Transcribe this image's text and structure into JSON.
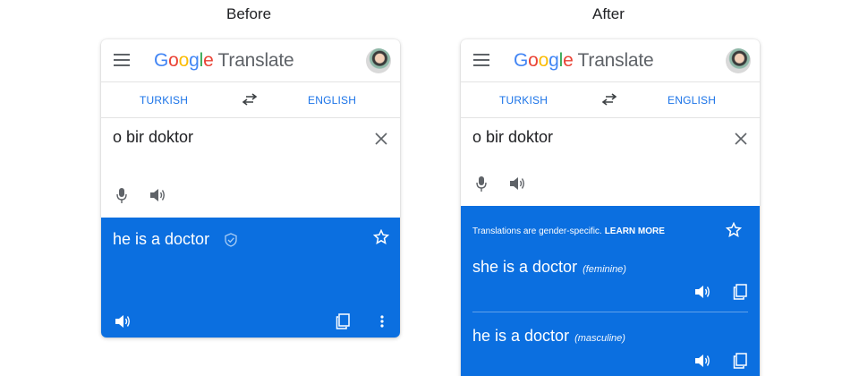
{
  "captions": {
    "before": "Before",
    "after": "After"
  },
  "app": {
    "logo_letters": [
      "G",
      "o",
      "o",
      "g",
      "l",
      "e"
    ],
    "product": "Translate"
  },
  "panels": {
    "before": {
      "source_lang": "TURKISH",
      "target_lang": "ENGLISH",
      "input_text": "o bir doktor",
      "translation": "he is a doctor"
    },
    "after": {
      "source_lang": "TURKISH",
      "target_lang": "ENGLISH",
      "input_text": "o bir doktor",
      "notice": "Translations are gender-specific.",
      "learn_more": "LEARN MORE",
      "translations": [
        {
          "text": "she is a doctor",
          "gender": "(feminine)"
        },
        {
          "text": "he is a doctor",
          "gender": "(masculine)"
        }
      ]
    }
  },
  "colors": {
    "accent": "#1a73e8",
    "result_bg": "#0b6fe0"
  },
  "icons": [
    "menu-icon",
    "swap-icon",
    "clear-icon",
    "mic-icon",
    "speaker-icon",
    "star-icon",
    "copy-icon",
    "more-icon",
    "shield-icon"
  ]
}
